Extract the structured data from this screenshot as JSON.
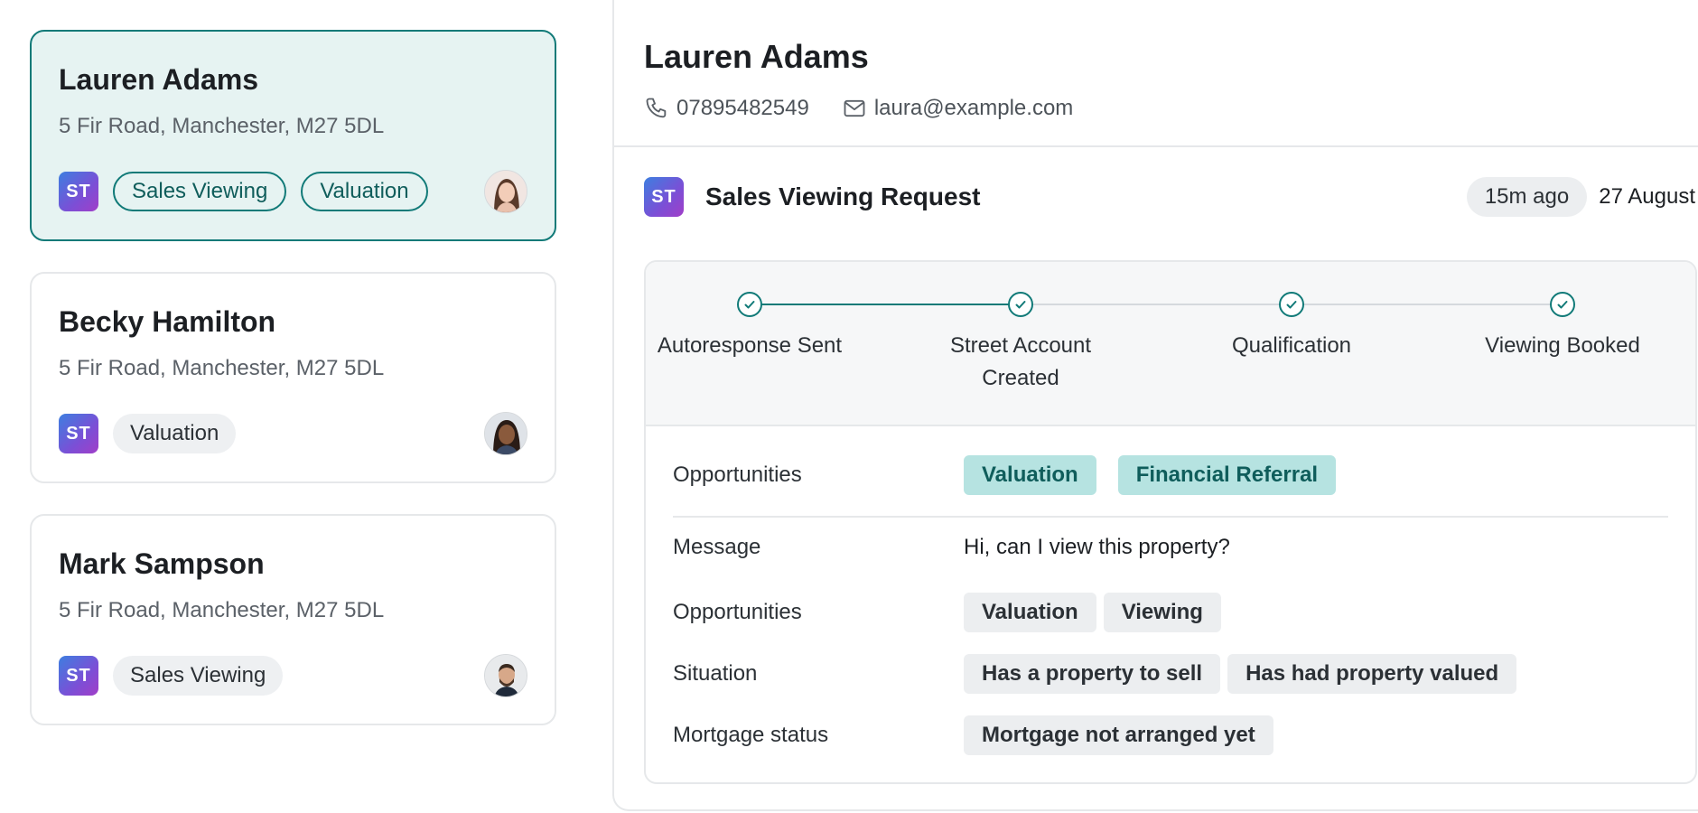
{
  "leads": [
    {
      "name": "Lauren Adams",
      "address": "5 Fir Road, Manchester, M27 5DL",
      "source_logo": "ST",
      "tags": [
        "Sales Viewing",
        "Valuation"
      ],
      "avatar": "woman-avatar-icon"
    },
    {
      "name": "Becky Hamilton",
      "address": "5 Fir Road, Manchester, M27 5DL",
      "source_logo": "ST",
      "tags": [
        "Valuation"
      ],
      "avatar": "woman-avatar-icon"
    },
    {
      "name": "Mark Sampson",
      "address": "5 Fir Road, Manchester, M27 5DL",
      "source_logo": "ST",
      "tags": [
        "Sales Viewing"
      ],
      "avatar": "man-avatar-icon"
    }
  ],
  "detail": {
    "name": "Lauren Adams",
    "phone": "07895482549",
    "email": "laura@example.com",
    "request": {
      "source_logo": "ST",
      "title": "Sales Viewing Request",
      "time_ago": "15m ago",
      "date": "27 August"
    },
    "steps": [
      {
        "label": "Autoresponse Sent",
        "done": true
      },
      {
        "label": "Street Account Created",
        "done": true
      },
      {
        "label": "Qualification",
        "done": true
      },
      {
        "label": "Viewing Booked",
        "done": true
      }
    ],
    "opportunities_label": "Opportunities",
    "opportunities": [
      "Valuation",
      "Financial Referral"
    ],
    "fields": {
      "message_label": "Message",
      "message": "Hi, can I view this property?",
      "opportunities_label": "Opportunities",
      "opportunities": [
        "Valuation",
        "Viewing"
      ],
      "situation_label": "Situation",
      "situation": [
        "Has a property to sell",
        "Has had property valued"
      ],
      "mortgage_label": "Mortgage status",
      "mortgage": [
        "Mortgage not arranged yet"
      ]
    }
  },
  "colors": {
    "accent": "#117a78",
    "selected_bg": "#e6f3f2",
    "teal_chip": "#b6e3e1",
    "grey_chip": "#eceef0"
  }
}
